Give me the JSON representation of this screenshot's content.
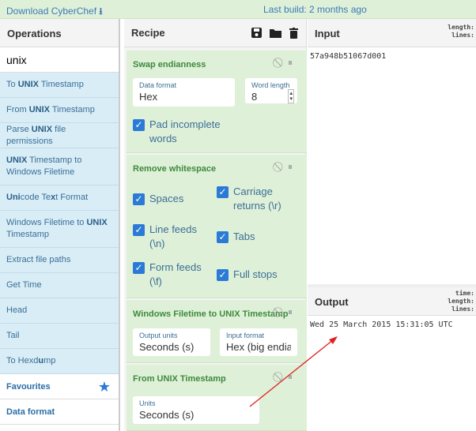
{
  "topbar": {
    "download": "Download CyberChef",
    "last_build": "Last build: 2 months ago"
  },
  "operations": {
    "title": "Operations",
    "search_value": "unix",
    "items": [
      {
        "pre": "To ",
        "b": "UNIX",
        "post": " Timestamp"
      },
      {
        "pre": "From ",
        "b": "UNIX",
        "post": " Timestamp"
      },
      {
        "pre": "Parse ",
        "b": "UNIX",
        "post": " file permissions"
      },
      {
        "pre": "",
        "b": "UNIX",
        "post": " Timestamp to Windows Filetime"
      },
      {
        "pre": "",
        "b": "Uni",
        "post": "code Te",
        "b2": "x",
        "post2": "t Format"
      },
      {
        "pre": "Windows Filetime to ",
        "b": "UNIX",
        "post": " Timestamp"
      },
      {
        "pre": "Extract file paths",
        "b": "",
        "post": ""
      },
      {
        "pre": "Get Time",
        "b": "",
        "post": ""
      },
      {
        "pre": "Head",
        "b": "",
        "post": ""
      },
      {
        "pre": "Tail",
        "b": "",
        "post": ""
      },
      {
        "pre": "To Hexd",
        "b": "u",
        "post": "mp"
      }
    ],
    "categories": [
      "Favourites",
      "Data format"
    ]
  },
  "recipe": {
    "title": "Recipe",
    "swap": {
      "title": "Swap endianness",
      "data_format_label": "Data format",
      "data_format": "Hex",
      "word_length_label": "Word length",
      "word_length": "8",
      "pad": "Pad incomplete words"
    },
    "whitespace": {
      "title": "Remove whitespace",
      "spaces": "Spaces",
      "carriage": "Carriage returns (\\r)",
      "line_feeds": "Line feeds (\\n)",
      "tabs": "Tabs",
      "form_feeds": "Form feeds (\\f)",
      "full_stops": "Full stops"
    },
    "filetime": {
      "title": "Windows Filetime to UNIX Timestamp",
      "output_units_label": "Output units",
      "output_units": "Seconds (s)",
      "input_format_label": "Input format",
      "input_format": "Hex (big endian)"
    },
    "from_unix": {
      "title": "From UNIX Timestamp",
      "units_label": "Units",
      "units": "Seconds (s)"
    }
  },
  "input": {
    "title": "Input",
    "value": "57a948b51067d001",
    "stats": [
      "length:",
      "lines:"
    ]
  },
  "output": {
    "title": "Output",
    "value": "Wed 25 March 2015 15:31:05 UTC",
    "stats": [
      "time:",
      "length:",
      "lines:"
    ]
  },
  "colors": {
    "accent": "#3a7ab8",
    "recipe_bg": "#dff0d8",
    "ops_bg": "#d9edf7",
    "checkbox": "#2a7ad6",
    "arrow": "#e02020"
  }
}
